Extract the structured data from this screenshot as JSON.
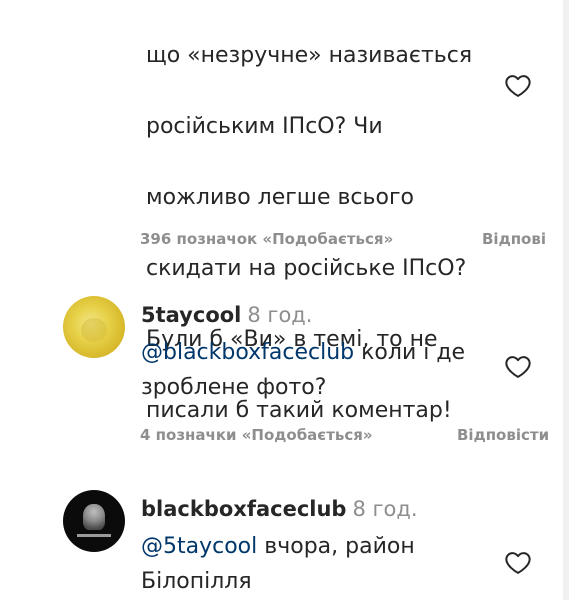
{
  "comments": [
    {
      "text_lines": [
        "що «незручне» називається",
        "російським ІПсО? Чи",
        "можливо легше всього",
        "скидати на російське ІПсО?",
        "Були б «Ви» в темі, то не",
        "писали б такий коментар!"
      ],
      "likes_label": "396 позначок «Подобається»",
      "reply_label": "Відпові"
    },
    {
      "username": "5taycool",
      "time": "8 год.",
      "mention": "@blackboxfaceclub",
      "text": "коли і де зроблене фото?",
      "likes_label": "4 позначки «Подобається»",
      "reply_label": "Відповісти"
    },
    {
      "username": "blackboxfaceclub",
      "time": "8 год.",
      "mention": "@5taycool",
      "text": "вчора, район Білопілля"
    }
  ],
  "icons": {
    "like": "heart-outline-icon"
  },
  "colors": {
    "text": "#262626",
    "meta": "#8e8e8e",
    "mention": "#00376b"
  }
}
